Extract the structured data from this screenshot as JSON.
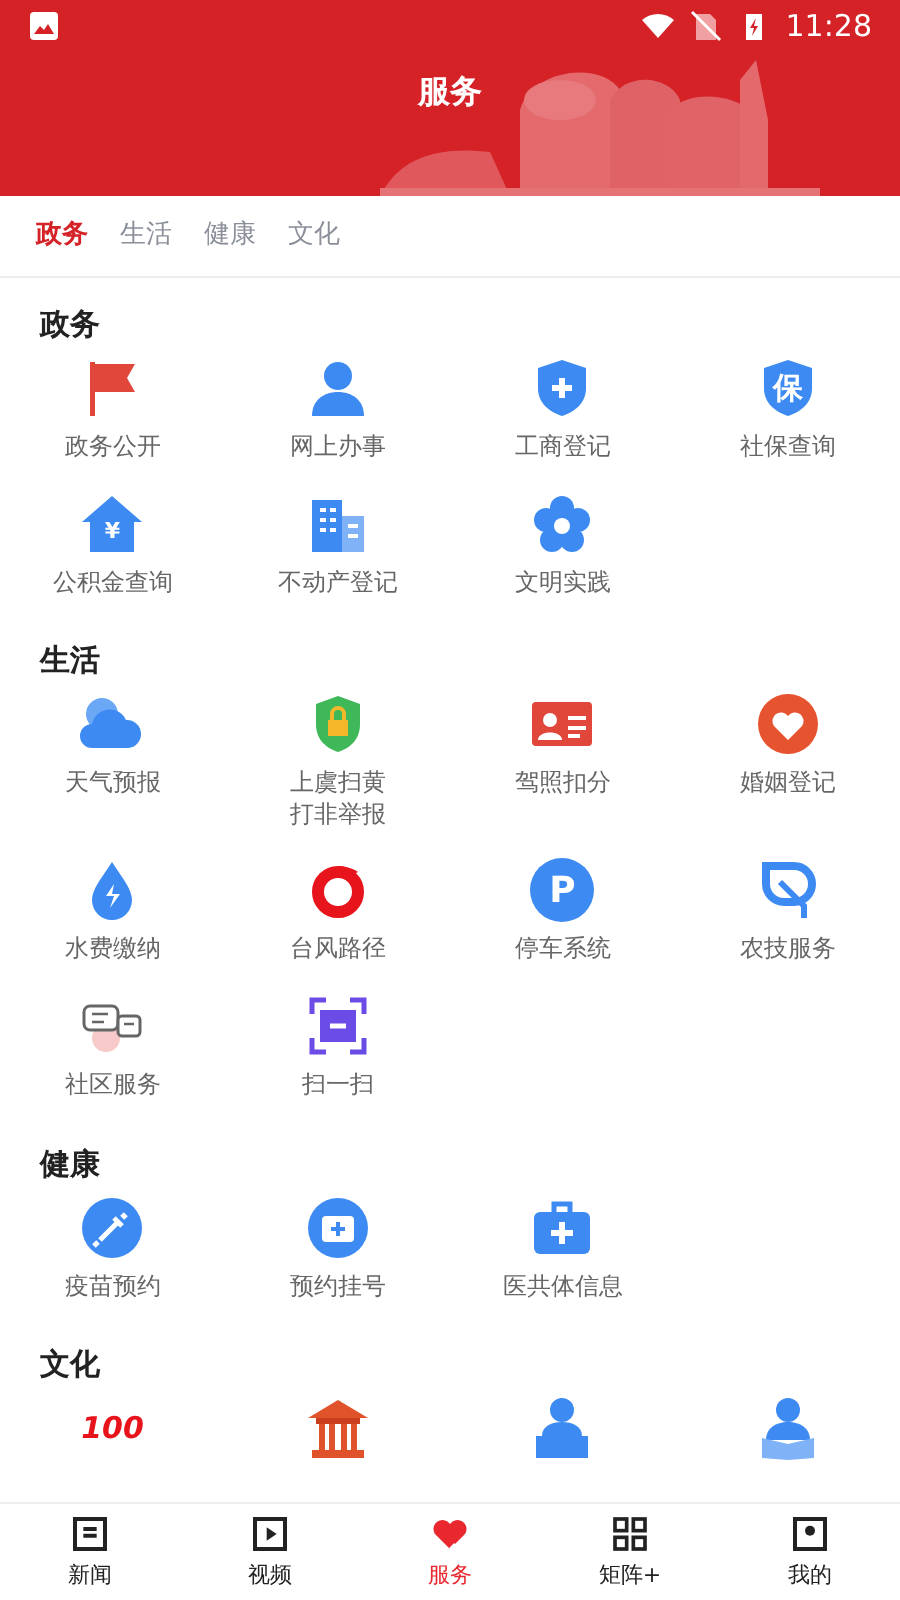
{
  "status_bar": {
    "time": "11:28"
  },
  "header": {
    "title": "服务"
  },
  "tabs": [
    {
      "label": "政务",
      "selected": true
    },
    {
      "label": "生活",
      "selected": false
    },
    {
      "label": "健康",
      "selected": false
    },
    {
      "label": "文化",
      "selected": false
    }
  ],
  "sections": [
    {
      "title": "政务",
      "items": [
        {
          "label": "政务公开"
        },
        {
          "label": "网上办事"
        },
        {
          "label": "工商登记"
        },
        {
          "label": "社保查询",
          "badge": "保"
        },
        {
          "label": "公积金查询",
          "badge": "¥"
        },
        {
          "label": "不动产登记"
        },
        {
          "label": "文明实践"
        }
      ]
    },
    {
      "title": "生活",
      "items": [
        {
          "label": "天气预报"
        },
        {
          "lines": [
            "上虞扫黄",
            "打非举报"
          ]
        },
        {
          "label": "驾照扣分"
        },
        {
          "label": "婚姻登记"
        },
        {
          "label": "水费缴纳"
        },
        {
          "label": "台风路径"
        },
        {
          "label": "停车系统",
          "badge": "P"
        },
        {
          "label": "农技服务"
        },
        {
          "label": "社区服务"
        },
        {
          "label": "扫一扫"
        }
      ]
    },
    {
      "title": "健康",
      "items": [
        {
          "label": "疫苗预约"
        },
        {
          "label": "预约挂号"
        },
        {
          "label": "医共体信息"
        }
      ]
    },
    {
      "title": "文化",
      "icon_row": {
        "badge": "100"
      }
    }
  ],
  "nav": [
    {
      "label": "新闻",
      "selected": false
    },
    {
      "label": "视频",
      "selected": false
    },
    {
      "label": "服务",
      "selected": true
    },
    {
      "label": "矩阵+",
      "selected": false
    },
    {
      "label": "我的",
      "selected": false
    }
  ]
}
